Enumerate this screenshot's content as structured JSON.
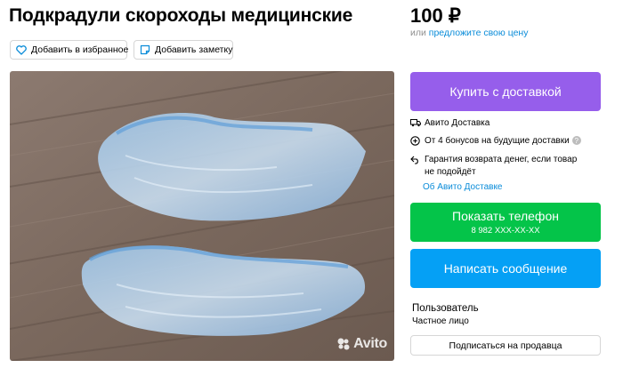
{
  "listing": {
    "title": "Подкрадули скороходы медицинские"
  },
  "price": {
    "value": "100 ₽",
    "alt_prefix": "или",
    "alt_link": "предложите свою цену"
  },
  "actions": {
    "favorite_label": "Добавить в избранное",
    "note_label": "Добавить заметку"
  },
  "photo": {
    "watermark": "Avito"
  },
  "buy": {
    "label": "Купить с доставкой"
  },
  "delivery": {
    "item1": "Авито Доставка",
    "item2": "От 4 бонусов на будущие доставки",
    "item2_help": "?",
    "item3_line1": "Гарантия возврата денег, если товар",
    "item3_line2": "не подойдёт",
    "link": "Об Авито Доставке"
  },
  "contact": {
    "phone_label": "Показать телефон",
    "phone_number": "8 982 XXX-XX-XX",
    "message_label": "Написать сообщение"
  },
  "seller": {
    "role": "Пользователь",
    "type": "Частное лицо",
    "subscribe_label": "Подписаться на продавца"
  },
  "colors": {
    "buy": "#965eeb",
    "phone": "#04c449",
    "message": "#05a0f5",
    "link": "#0a8cd9"
  },
  "icons": {
    "favorite": "heart-icon",
    "note": "note-icon",
    "delivery": "truck-icon",
    "bonus": "bonus-icon",
    "guarantee": "return-icon"
  }
}
